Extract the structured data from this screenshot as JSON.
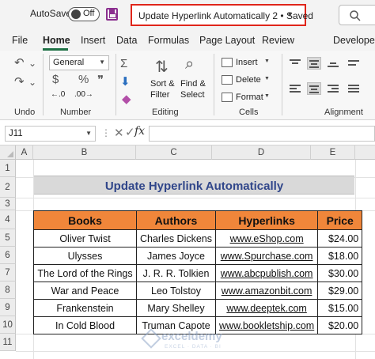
{
  "titlebar": {
    "autosave_label": "AutoSave",
    "toggle_state": "Off",
    "document_title": "Update Hyperlink Automatically 2 • Saved"
  },
  "tabs": [
    "File",
    "Home",
    "Insert",
    "Data",
    "Formulas",
    "Page Layout",
    "Review",
    "Developer"
  ],
  "active_tab": "Home",
  "ribbon": {
    "groups": {
      "undo": "Undo",
      "number": "Number",
      "editing": "Editing",
      "cells": "Cells",
      "alignment": "Alignment"
    },
    "number_format": "General",
    "sort_filter": [
      "Sort &",
      "Filter"
    ],
    "find_select": [
      "Find &",
      "Select"
    ],
    "insert_label": "Insert",
    "delete_label": "Delete",
    "format_label": "Format",
    "currency_symbol": "$",
    "percent_symbol": "%"
  },
  "formula_bar": {
    "name_box": "J11",
    "fx": "fx",
    "formula": ""
  },
  "columns": [
    "A",
    "B",
    "C",
    "D",
    "E"
  ],
  "rows": [
    "1",
    "2",
    "3",
    "4",
    "5",
    "6",
    "7",
    "8",
    "9",
    "10",
    "11"
  ],
  "sheet": {
    "title": "Update Hyperlink Automatically",
    "headers": [
      "Books",
      "Authors",
      "Hyperlinks",
      "Price"
    ],
    "records": [
      [
        "Oliver Twist",
        "Charles Dickens",
        "www.eShop.com",
        "$24.00"
      ],
      [
        "Ulysses",
        "James Joyce",
        "www.Spurchase.com",
        "$18.00"
      ],
      [
        "The Lord of the Rings",
        "J. R. R. Tolkien",
        "www.abcpublish.com",
        "$30.00"
      ],
      [
        "War and Peace",
        "Leo Tolstoy",
        "www.amazonbit.com",
        "$29.00"
      ],
      [
        "Frankenstein",
        "Mary Shelley",
        "www.deeptek.com",
        "$15.00"
      ],
      [
        "In Cold Blood",
        "Truman Capote",
        "www.bookletship.com",
        "$20.00"
      ]
    ]
  },
  "watermark": {
    "name": "exceldemy",
    "tagline": "EXCEL · DATA · BI"
  },
  "colors": {
    "header_fill": "#f0863a",
    "title_fill": "#d9d9d9",
    "title_text": "#30468a",
    "link": "#1f5fbf",
    "highlight_border": "#e0261b",
    "accent": "#1e7145"
  }
}
